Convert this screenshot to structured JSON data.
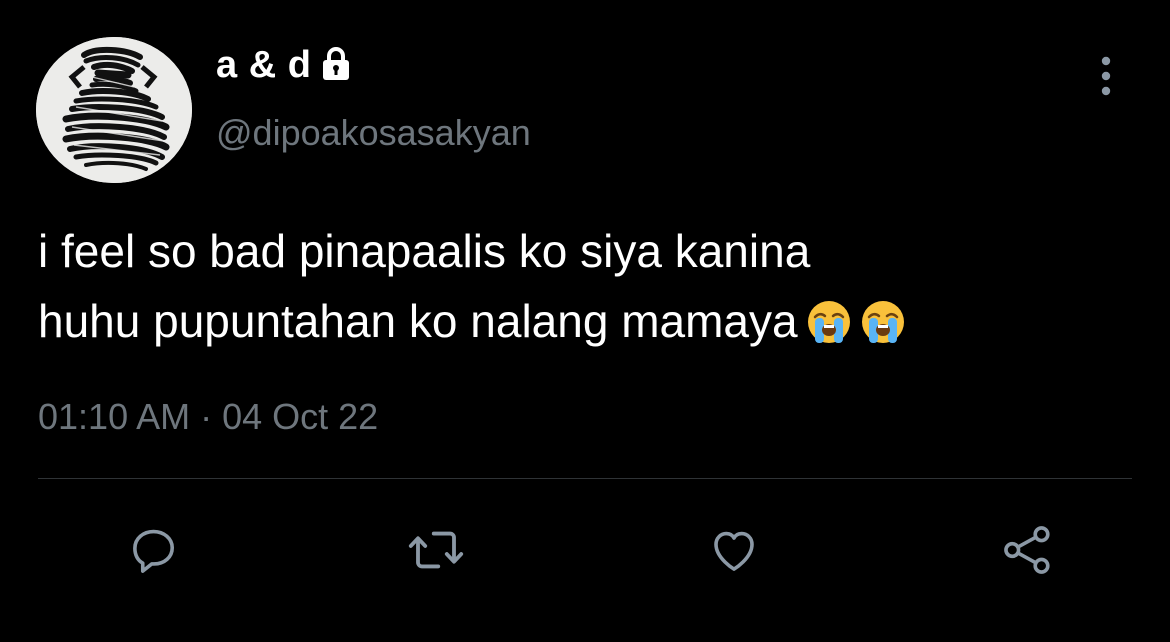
{
  "author": {
    "display_name": "a & d",
    "handle": "@dipoakosasakyan",
    "protected_icon": "lock-icon"
  },
  "tweet": {
    "text_line_1": "i feel so bad pinapaalis ko siya kanina",
    "text_line_2": "huhu pupuntahan ko nalang mamaya",
    "emojis": [
      "loudly-crying-face-emoji",
      "loudly-crying-face-emoji"
    ],
    "timestamp": "01:10 AM · 04 Oct 22"
  },
  "actions": {
    "icons": [
      "reply-icon",
      "retweet-icon",
      "like-icon",
      "share-icon"
    ],
    "more_icon": "more-vertical-icon"
  },
  "colors": {
    "background": "#000000",
    "primary_text": "#ffffff",
    "secondary_text": "#6e767d",
    "divider": "#2f3336",
    "icon": "#8b98a5"
  }
}
